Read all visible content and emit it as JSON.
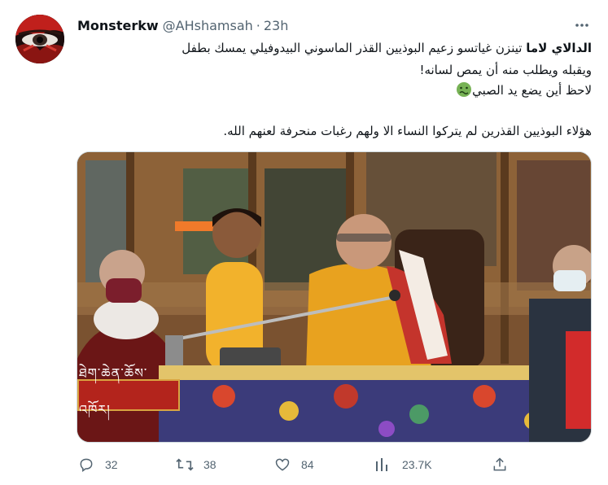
{
  "tweet": {
    "author": {
      "display_name": "Monsterkw",
      "handle": "@AHshamsah",
      "separator": "·",
      "time": "23h"
    },
    "more_icon": "more-horizontal-icon",
    "text": {
      "line1_bold": "الدالاي لاما",
      "line1_rest": " تينزن غياتسو زعيم البوذيين القذر الماسوني البيدوفيلي يمسك بطفل",
      "line2": "ويقبله ويطلب منه أن يمص لسانه!",
      "line3": "لاحظ أين يضع يد الصبي",
      "line3_emoji": "nauseated-face-emoji",
      "line4": "هؤلاء البوذيين القذرين لم يتركوا النساء الا ولهم رغبات منحرفة لعنهم الله."
    },
    "media": {
      "caption": "ཐེག་ཆེན་ཆོས་འཁོར།"
    },
    "actions": {
      "reply": {
        "icon": "reply-icon",
        "count": "32"
      },
      "retweet": {
        "icon": "retweet-icon",
        "count": "38"
      },
      "like": {
        "icon": "heart-icon",
        "count": "84"
      },
      "views": {
        "icon": "views-chart-icon",
        "count": "23.7K"
      },
      "share": {
        "icon": "share-icon"
      }
    }
  },
  "colors": {
    "text_primary": "#0f1419",
    "text_secondary": "#536471",
    "border": "#cfd9de",
    "caption_red": "#b3241c"
  }
}
